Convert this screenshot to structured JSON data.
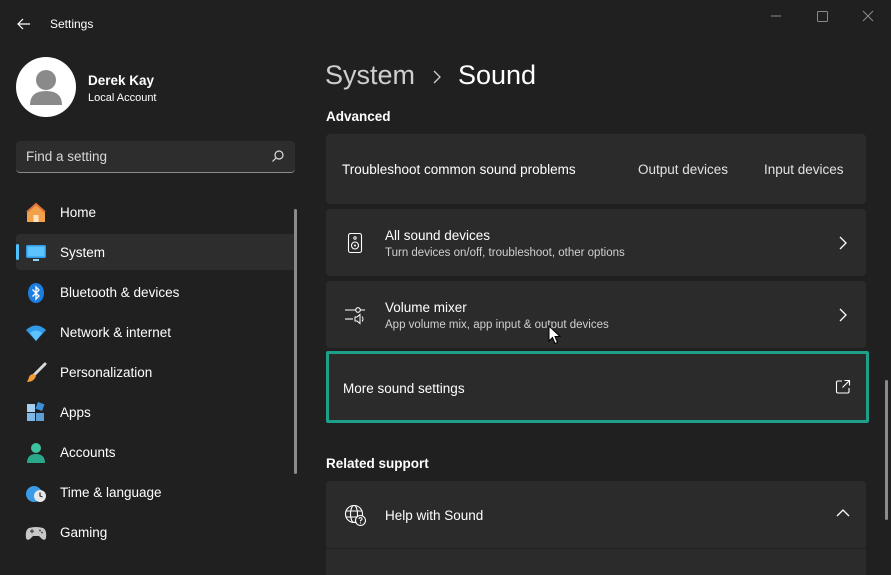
{
  "window": {
    "title": "Settings"
  },
  "profile": {
    "name": "Derek Kay",
    "account_type": "Local Account"
  },
  "search": {
    "placeholder": "Find a setting"
  },
  "nav": {
    "items": [
      {
        "label": "Home",
        "icon": "home-icon"
      },
      {
        "label": "System",
        "icon": "system-icon",
        "active": true
      },
      {
        "label": "Bluetooth & devices",
        "icon": "bluetooth-icon"
      },
      {
        "label": "Network & internet",
        "icon": "wifi-icon"
      },
      {
        "label": "Personalization",
        "icon": "brush-icon"
      },
      {
        "label": "Apps",
        "icon": "apps-icon"
      },
      {
        "label": "Accounts",
        "icon": "accounts-icon"
      },
      {
        "label": "Time & language",
        "icon": "clock-globe-icon"
      },
      {
        "label": "Gaming",
        "icon": "gamepad-icon"
      }
    ]
  },
  "breadcrumb": {
    "parent": "System",
    "current": "Sound"
  },
  "advanced": {
    "header": "Advanced",
    "troubleshoot": {
      "label": "Troubleshoot common sound problems",
      "output_link": "Output devices",
      "input_link": "Input devices"
    },
    "all_devices": {
      "title": "All sound devices",
      "subtitle": "Turn devices on/off, troubleshoot, other options"
    },
    "volume_mixer": {
      "title": "Volume mixer",
      "subtitle": "App volume mix, app input & output devices"
    },
    "more_settings": {
      "title": "More sound settings"
    }
  },
  "related": {
    "header": "Related support",
    "help": {
      "title": "Help with Sound"
    }
  },
  "colors": {
    "accent": "#4cc2ff",
    "highlight": "#1e9f8a",
    "background": "#202020",
    "card": "#2b2b2b"
  }
}
